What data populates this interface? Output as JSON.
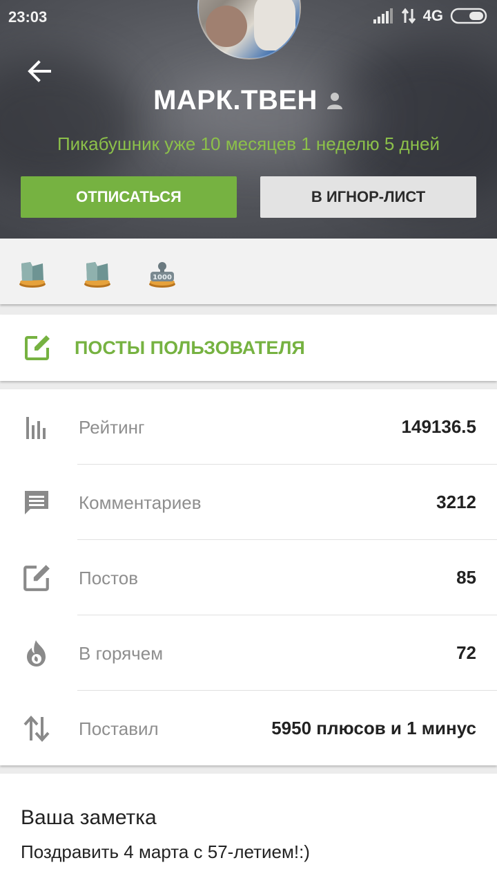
{
  "status_bar": {
    "time": "23:03",
    "network": "4G",
    "icons": [
      "signal-icon",
      "data-transfer-icon",
      "battery-icon"
    ]
  },
  "profile": {
    "username": "МАРК.ТВЕН",
    "member_since": "Пикабушник уже 10 месяцев 1 неделю 5 дней",
    "unsubscribe_label": "ОТПИСАТЬСЯ",
    "ignore_label": "В ИГНОР-ЛИСТ"
  },
  "awards": [
    {
      "icon": "award-stone-icon"
    },
    {
      "icon": "award-stone-icon"
    },
    {
      "icon": "award-1000-icon",
      "text": "1000"
    }
  ],
  "posts_link": {
    "label": "ПОСТЫ ПОЛЬЗОВАТЕЛЯ",
    "icon": "edit-icon"
  },
  "stats": [
    {
      "icon": "rating-bars-icon",
      "label": "Рейтинг",
      "value": "149136.5"
    },
    {
      "icon": "comment-icon",
      "label": "Комментариев",
      "value": "3212"
    },
    {
      "icon": "edit-icon",
      "label": "Постов",
      "value": "85"
    },
    {
      "icon": "fire-icon",
      "label": "В горячем",
      "value": "72"
    },
    {
      "icon": "up-down-arrows-icon",
      "label": "Поставил",
      "value": "5950 плюсов и 1 минус"
    }
  ],
  "note": {
    "title": "Ваша заметка",
    "text": "Поздравить 4 марта с 57-летием!:)"
  },
  "colors": {
    "accent_green": "#76b241",
    "member_since_green": "#8cc04a",
    "ignore_button_bg": "#e3e3e3",
    "label_gray": "#8e8e8e"
  }
}
